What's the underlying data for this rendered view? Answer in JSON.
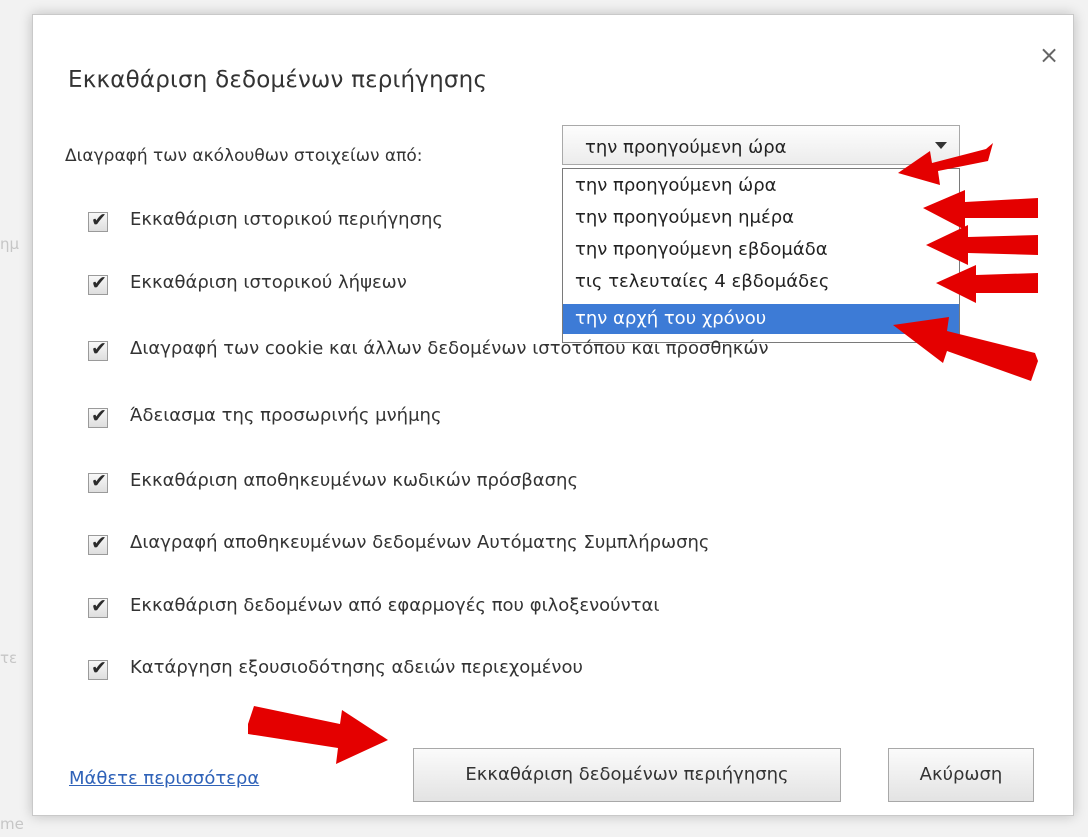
{
  "dialog": {
    "title": "Εκκαθάριση δεδομένων περιήγησης",
    "close_label": "×"
  },
  "period": {
    "label": "Διαγραφή των ακόλουθων στοιχείων από:",
    "selected_value": "την προηγούμενη ώρα",
    "options": [
      {
        "label": "την προηγούμενη ώρα",
        "selected": false
      },
      {
        "label": "την προηγούμενη ημέρα",
        "selected": false
      },
      {
        "label": "την προηγούμενη εβδομάδα",
        "selected": false
      },
      {
        "label": "τις τελευταίες 4 εβδομάδες",
        "selected": false
      },
      {
        "label": "την αρχή του χρόνου",
        "selected": true
      }
    ]
  },
  "options": [
    {
      "label": "Εκκαθάριση ιστορικού περιήγησης",
      "checked": true
    },
    {
      "label": "Εκκαθάριση ιστορικού λήψεων",
      "checked": true
    },
    {
      "label": "Διαγραφή των cookie και άλλων δεδομένων ιστοτόπου και προσθηκών",
      "checked": true
    },
    {
      "label": "Άδειασμα της προσωρινής μνήμης",
      "checked": true
    },
    {
      "label": "Εκκαθάριση αποθηκευμένων κωδικών πρόσβασης",
      "checked": true
    },
    {
      "label": "Διαγραφή αποθηκευμένων δεδομένων Αυτόματης Συμπλήρωσης",
      "checked": true
    },
    {
      "label": "Εκκαθάριση δεδομένων από εφαρμογές που φιλοξενούνται",
      "checked": true
    },
    {
      "label": "Κατάργηση εξουσιοδότησης αδειών περιεχομένου",
      "checked": true
    }
  ],
  "footer": {
    "learn_more": "Μάθετε περισσότερα",
    "clear_button": "Εκκαθάριση δεδομένων περιήγησης",
    "cancel_button": "Ακύρωση"
  },
  "annotations": {
    "arrow_color": "#e40000"
  },
  "background": {
    "fragments": [
      "ημ",
      "τε",
      "me"
    ]
  }
}
